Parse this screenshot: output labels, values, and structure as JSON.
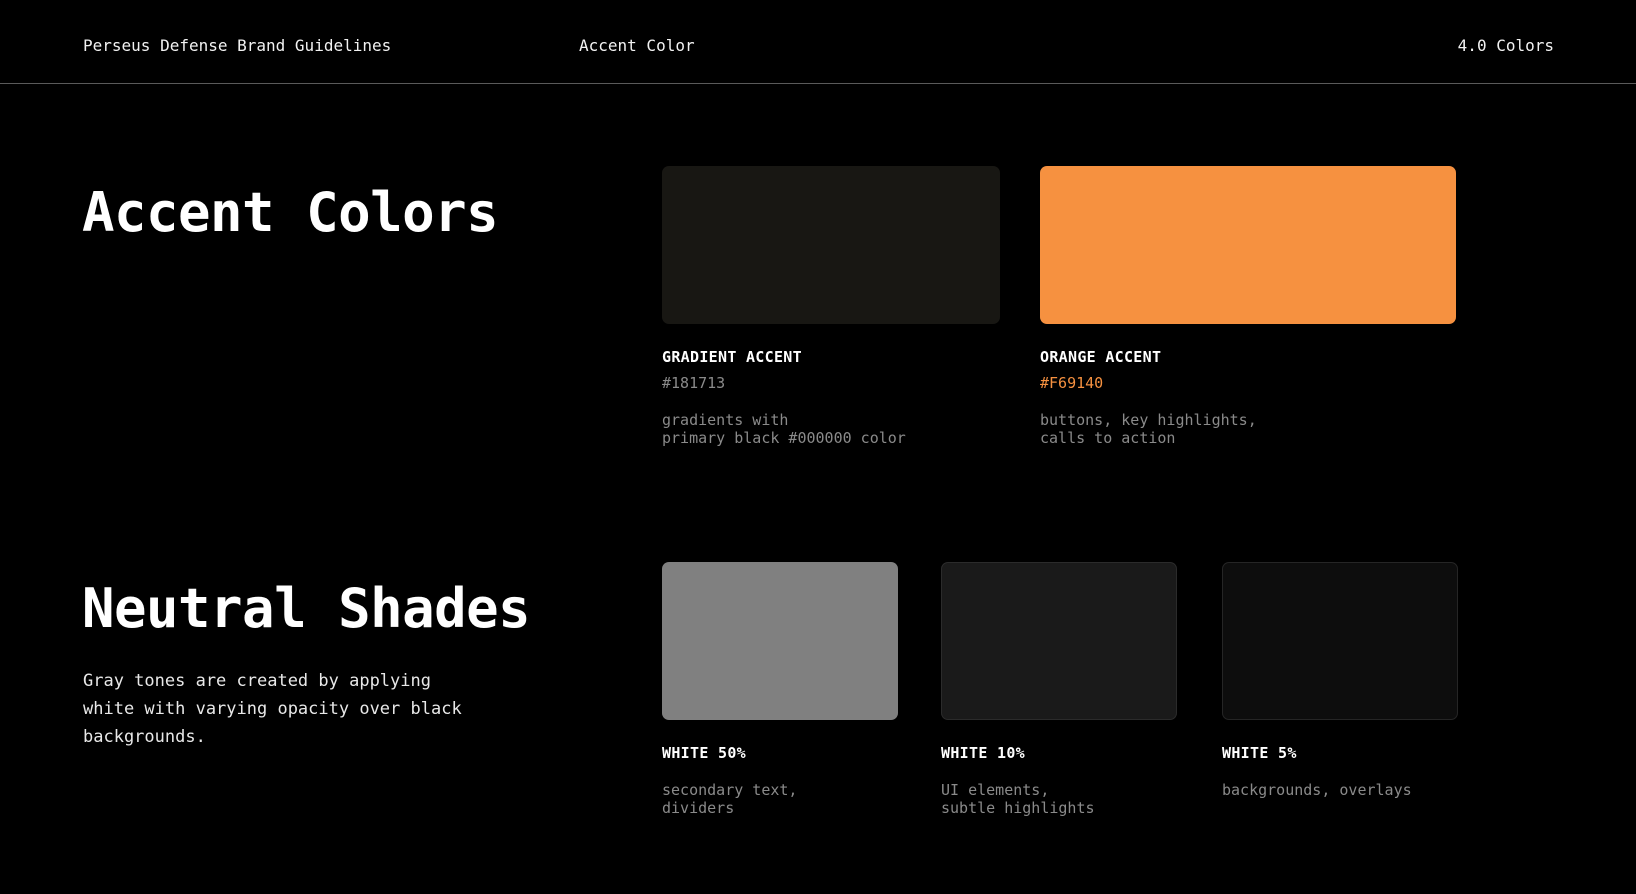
{
  "header": {
    "brand": "Perseus Defense Brand Guidelines",
    "page_topic": "Accent Color",
    "section_ref": "4.0 Colors"
  },
  "accent_section": {
    "title": "Accent Colors",
    "swatches": [
      {
        "name": "GRADIENT ACCENT",
        "hex": "#181713",
        "usage": "gradients with\nprimary black #000000 color",
        "color": "#181713",
        "hex_text_color": "#8a8a8a"
      },
      {
        "name": "ORANGE ACCENT",
        "hex": "#F69140",
        "usage": "buttons, key highlights,\ncalls to action",
        "color": "#F69140",
        "hex_text_color": "#F69140"
      }
    ]
  },
  "neutral_section": {
    "title": "Neutral Shades",
    "description": "Gray tones are created by applying white with varying opacity over black backgrounds.",
    "swatches": [
      {
        "name": "WHITE 50%",
        "usage": "secondary text,\ndividers",
        "opacity": 0.5
      },
      {
        "name": "WHITE 10%",
        "usage": "UI elements,\nsubtle highlights",
        "opacity": 0.1
      },
      {
        "name": "WHITE 5%",
        "usage": "backgrounds, overlays",
        "opacity": 0.05
      }
    ]
  },
  "colors": {
    "background": "#000000",
    "text_primary": "#ffffff",
    "text_muted": "#8a8a8a",
    "divider": "#5a5a5a"
  }
}
